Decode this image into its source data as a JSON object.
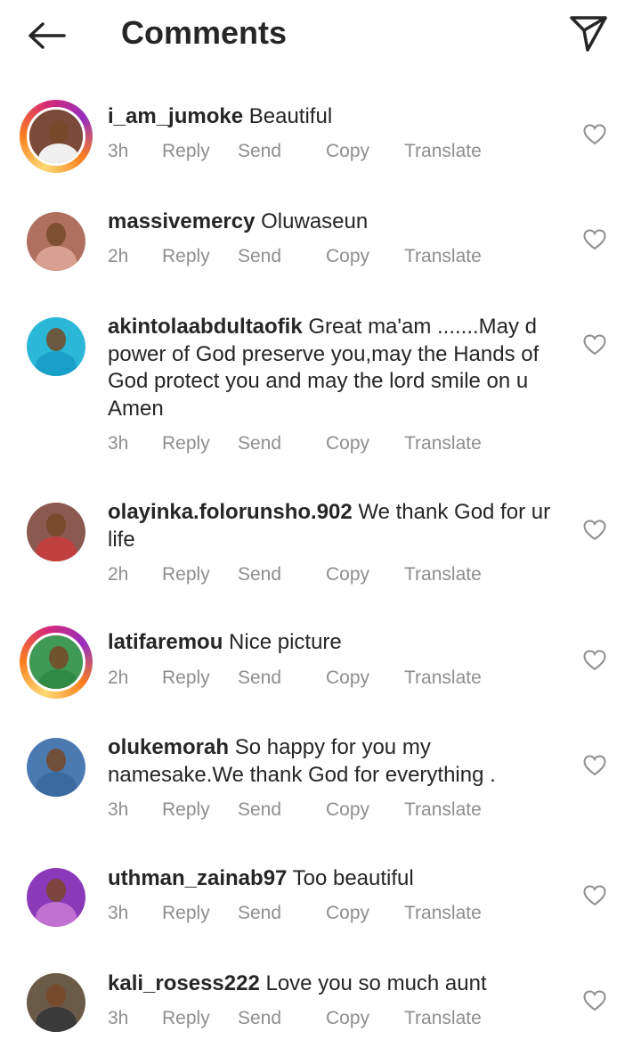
{
  "header": {
    "title": "Comments"
  },
  "actions": {
    "reply": "Reply",
    "send": "Send",
    "copy": "Copy",
    "translate": "Translate"
  },
  "comments": [
    {
      "username": "i_am_jumoke",
      "text": "Beautiful",
      "time": "3h",
      "story_ring": true,
      "avatar_color": "#7a4a3a"
    },
    {
      "username": "massivemercy",
      "text": "Oluwaseun",
      "time": "2h",
      "story_ring": false,
      "avatar_color": "#b07060"
    },
    {
      "username": "akintolaabdultaofik",
      "text": "Great ma'am .......May d power of God preserve you,may the Hands of God protect you and may the lord smile on u Amen",
      "time": "3h",
      "story_ring": false,
      "avatar_color": "#2bb8d8"
    },
    {
      "username": "olayinka.folorunsho.902",
      "text": "We thank God for ur life",
      "time": "2h",
      "story_ring": false,
      "avatar_color": "#8a5a50"
    },
    {
      "username": "latifaremou",
      "text": "Nice picture",
      "time": "2h",
      "story_ring": true,
      "avatar_color": "#3f9a55"
    },
    {
      "username": "olukemorah",
      "text": "So happy for you my namesake.We thank God for everything .",
      "time": "3h",
      "story_ring": false,
      "avatar_color": "#4a7ab0"
    },
    {
      "username": "uthman_zainab97",
      "text": "Too beautiful",
      "time": "3h",
      "story_ring": false,
      "avatar_color": "#8a3ab8"
    },
    {
      "username": "kali_rosess222",
      "text": "Love you so much aunt",
      "time": "3h",
      "story_ring": false,
      "avatar_color": "#6a5a48"
    }
  ]
}
